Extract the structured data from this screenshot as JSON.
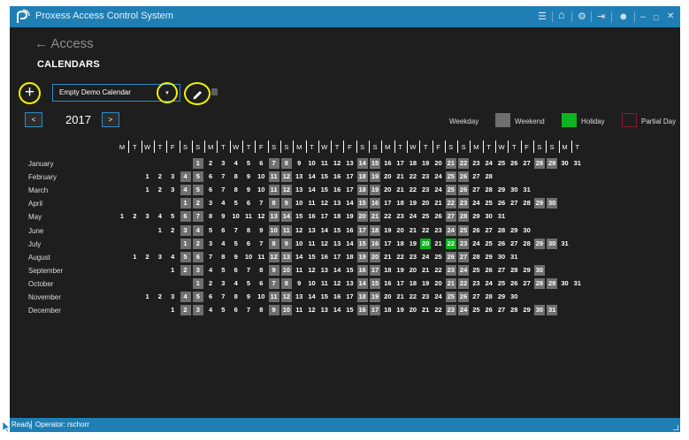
{
  "window": {
    "title": "Proxess Access Control System",
    "buttons": {
      "menu": "☰",
      "home": "⌂",
      "settings": "⚙",
      "logout": "⇥",
      "user": "☻",
      "minimize": "–",
      "maximize": "□",
      "close": "✕"
    }
  },
  "header": {
    "back_label": "← Access",
    "title": "CALENDARS"
  },
  "toolbar": {
    "add_label": "+",
    "calendar_selected": "Empty Demo Calendar",
    "dropdown_arrow": "▾",
    "edit_icon": "pencil-icon"
  },
  "year_nav": {
    "prev": "<",
    "next": ">",
    "year": "2017"
  },
  "legend": [
    {
      "label": "Weekday",
      "color": "#1e1e1e"
    },
    {
      "label": "Weekend",
      "color": "#6f6f6f"
    },
    {
      "label": "Holiday",
      "color": "#0db320"
    },
    {
      "label": "Partial Day",
      "color": "#8b1a2e"
    }
  ],
  "weekday_headers": [
    "M",
    "T",
    "W",
    "T",
    "F",
    "S",
    "S"
  ],
  "months": [
    {
      "name": "January",
      "first_weekday": 6,
      "days": 31,
      "holidays": []
    },
    {
      "name": "February",
      "first_weekday": 2,
      "days": 28,
      "holidays": []
    },
    {
      "name": "March",
      "first_weekday": 2,
      "days": 31,
      "holidays": []
    },
    {
      "name": "April",
      "first_weekday": 5,
      "days": 30,
      "holidays": []
    },
    {
      "name": "May",
      "first_weekday": 0,
      "days": 31,
      "holidays": []
    },
    {
      "name": "June",
      "first_weekday": 3,
      "days": 30,
      "holidays": []
    },
    {
      "name": "July",
      "first_weekday": 5,
      "days": 31,
      "holidays": [
        20,
        22
      ]
    },
    {
      "name": "August",
      "first_weekday": 1,
      "days": 31,
      "holidays": []
    },
    {
      "name": "September",
      "first_weekday": 4,
      "days": 30,
      "holidays": []
    },
    {
      "name": "October",
      "first_weekday": 6,
      "days": 31,
      "holidays": []
    },
    {
      "name": "November",
      "first_weekday": 2,
      "days": 30,
      "holidays": []
    },
    {
      "name": "December",
      "first_weekday": 4,
      "days": 31,
      "holidays": []
    }
  ],
  "status": {
    "ready": "Ready",
    "operator": "Operator: rschorr"
  }
}
